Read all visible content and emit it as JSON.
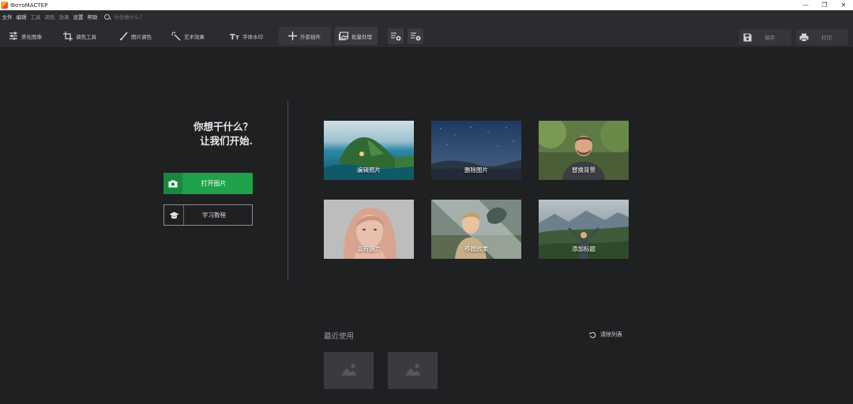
{
  "window": {
    "title": "ФотоМАСТЕР",
    "controls": [
      "—",
      "❐",
      "✕"
    ]
  },
  "menu": {
    "items": [
      {
        "label": "文件",
        "dim": false
      },
      {
        "label": "编辑",
        "dim": false
      },
      {
        "label": "工具",
        "dim": true
      },
      {
        "label": "调色",
        "dim": true
      },
      {
        "label": "效果",
        "dim": true
      },
      {
        "label": "设置",
        "dim": false
      },
      {
        "label": "帮助",
        "dim": false
      }
    ],
    "search_placeholder": "你想做什么？"
  },
  "toolbar": {
    "tabs": [
      {
        "label": "美化图像",
        "icon": "sliders-icon"
      },
      {
        "label": "调色工具",
        "icon": "crop-icon"
      },
      {
        "label": "图片调色",
        "icon": "brush-icon"
      },
      {
        "label": "艺术效果",
        "icon": "magic-wand-icon"
      },
      {
        "label": "字体水印",
        "icon": "text-icon"
      },
      {
        "label": "外部插件",
        "icon": "plus-icon"
      }
    ],
    "batch_label": "批量处理",
    "save_label": "保存",
    "print_label": "打印"
  },
  "welcome": {
    "line1": "你想干什么？",
    "line2": "让我们开始."
  },
  "actions": {
    "open_label": "打开图片",
    "learn_label": "学习教程"
  },
  "cards": [
    {
      "label": "编辑照片"
    },
    {
      "label": "删除图片"
    },
    {
      "label": "替换背景"
    },
    {
      "label": "富有魅力"
    },
    {
      "label": "移圆效果"
    },
    {
      "label": "添加标题"
    }
  ],
  "recent": {
    "title": "最近使用",
    "clear_label": "清除列表"
  },
  "colors": {
    "background": "#1f2022",
    "toolbar": "#2b2c2f",
    "accent_green": "#1ea24a"
  }
}
